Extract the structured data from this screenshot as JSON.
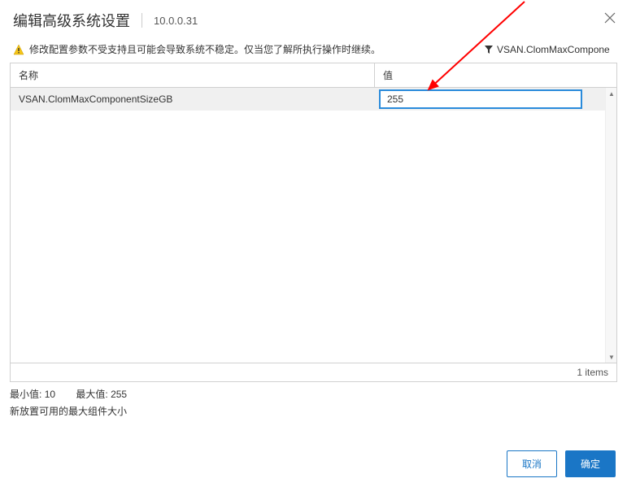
{
  "header": {
    "title": "编辑高级系统设置",
    "ip": "10.0.0.31"
  },
  "warning": {
    "text": "修改配置参数不受支持且可能会导致系统不稳定。仅当您了解所执行操作时继续。"
  },
  "filter": {
    "text": "VSAN.ClomMaxCompone"
  },
  "columns": {
    "name": "名称",
    "value": "值"
  },
  "rows": [
    {
      "name": "VSAN.ClomMaxComponentSizeGB",
      "value": "255"
    }
  ],
  "footer": {
    "items": "1 items"
  },
  "info": {
    "min_label": "最小值:",
    "min_value": "10",
    "max_label": "最大值:",
    "max_value": "255",
    "description": "新放置可用的最大组件大小"
  },
  "buttons": {
    "cancel": "取消",
    "confirm": "确定"
  }
}
